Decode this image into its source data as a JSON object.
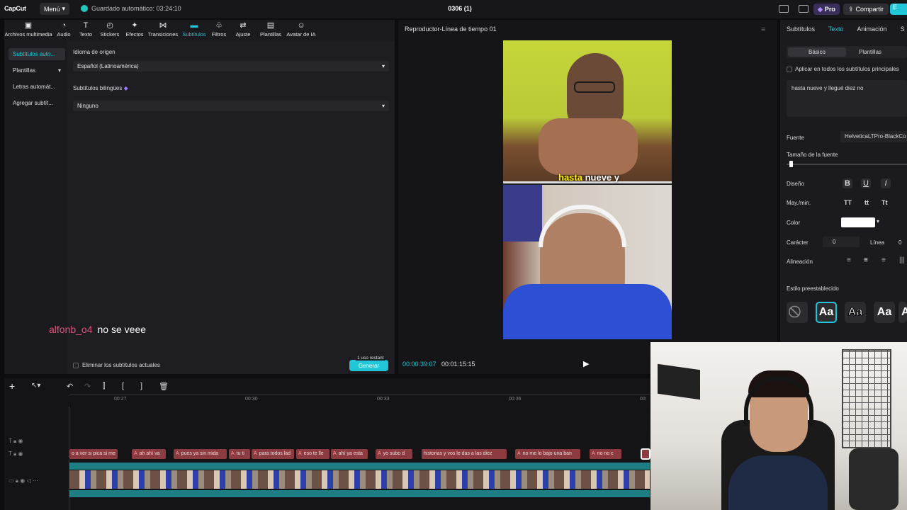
{
  "titlebar": {
    "logo": "CapCut",
    "menu": "Menú",
    "autosave": "Guardado automático: 03:24:10",
    "project": "0306 (1)",
    "pro": "Pro",
    "share": "Compartir",
    "export": "E"
  },
  "toolbar": [
    {
      "icon": "media-icon",
      "glyph": "▣",
      "label": "Archivos multimedia"
    },
    {
      "icon": "audio-icon",
      "glyph": "◔",
      "label": "Audio"
    },
    {
      "icon": "text-icon",
      "glyph": "T",
      "label": "Texto"
    },
    {
      "icon": "sticker-icon",
      "glyph": "◴",
      "label": "Stickers"
    },
    {
      "icon": "effects-icon",
      "glyph": "✦",
      "label": "Efectos"
    },
    {
      "icon": "transitions-icon",
      "glyph": "⋈",
      "label": "Transiciones"
    },
    {
      "icon": "subtitles-icon",
      "glyph": "▬",
      "label": "Subtítulos"
    },
    {
      "icon": "filters-icon",
      "glyph": "♧",
      "label": "Filtros"
    },
    {
      "icon": "adjust-icon",
      "glyph": "⇄",
      "label": "Ajuste"
    },
    {
      "icon": "templates-icon",
      "glyph": "▤",
      "label": "Plantillas"
    },
    {
      "icon": "avatar-icon",
      "glyph": "☺",
      "label": "Avatar de IA"
    }
  ],
  "left_nav": [
    "Subtítulos auto...",
    "Plantillas",
    "Letras automát...",
    "Agregar subtít..."
  ],
  "subtitle_panel": {
    "source_label": "Idioma de origen",
    "source_value": "Español (Latinoamérica)",
    "bilingual_label": "Subtítulos bilingües",
    "bilingual_value": "Ninguno",
    "delete_label": "Eliminar los subtítulos actuales",
    "badge": "1 uso restant",
    "generate": "Generar"
  },
  "chat": {
    "user": "alfonb_o4",
    "message": "no se veee",
    "user_color": "#e0537a"
  },
  "player": {
    "title": "Reproductor-Línea de tiempo 01",
    "current": "00:00:39:07",
    "total": "00:01:15:15",
    "caption_highlight": "hasta",
    "caption_rest": "nueve y"
  },
  "right_panel": {
    "tabs": [
      "Subtítulos",
      "Texto",
      "Animación",
      "S"
    ],
    "subtabs": [
      "Básico",
      "Plantillas"
    ],
    "apply_all": "Aplicar en todos los subtítulos principales",
    "text_value": "hasta nueve y llegué diez no",
    "font_label": "Fuente",
    "font_value": "HelveticaLTPro-BlackCo",
    "size_label": "Tamaño de la fuente",
    "design_label": "Diseño",
    "design_buttons": [
      "B",
      "U",
      "I"
    ],
    "case_label": "May./min.",
    "case_buttons": [
      "TT",
      "tt",
      "Tt"
    ],
    "color_label": "Color",
    "color_value": "#ffffff",
    "char_label": "Carácter",
    "char_value": "0",
    "line_label": "Línea",
    "line_value": "0",
    "align_label": "Alineación",
    "preset_label": "Estilo preestablecido",
    "presets": [
      "⃠",
      "Aa",
      "Aa",
      "Aa",
      "A"
    ]
  },
  "timeline": {
    "ticks": [
      "00:27",
      "00:30",
      "00:33",
      "00:36",
      "00:"
    ],
    "clips": [
      {
        "text": "o a ver si pica si me"
      },
      {
        "tag": "A",
        "text": "ah ahí va"
      },
      {
        "tag": "A",
        "text": "pues ya sin mida"
      },
      {
        "tag": "A",
        "text": "tu ti"
      },
      {
        "tag": "A",
        "text": "para todos lad"
      },
      {
        "tag": "A",
        "text": "eso te lle"
      },
      {
        "tag": "A",
        "text": "ahí ya esta"
      },
      {
        "tag": "A",
        "text": "yo subo d"
      },
      {
        "tag": "",
        "text": "historias y vos le das a las diez"
      },
      {
        "tag": "A",
        "text": "no me lo bajo una ban"
      },
      {
        "tag": "A",
        "text": "no no c"
      }
    ]
  },
  "accent": "#21c7d9"
}
